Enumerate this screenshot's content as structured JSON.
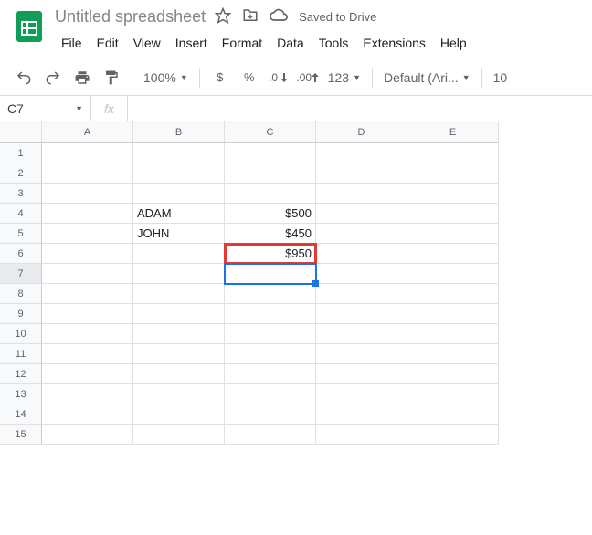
{
  "header": {
    "title": "Untitled spreadsheet",
    "saved_label": "Saved to Drive"
  },
  "menubar": [
    "File",
    "Edit",
    "View",
    "Insert",
    "Format",
    "Data",
    "Tools",
    "Extensions",
    "Help"
  ],
  "toolbar": {
    "zoom": "100%",
    "currency": "$",
    "percent": "%",
    "dec_dec": ".0",
    "inc_dec": ".00",
    "numfmt": "123",
    "font": "Default (Ari...",
    "fontsize": "10"
  },
  "formula_bar": {
    "name_box": "C7",
    "fx": "fx",
    "value": ""
  },
  "columns": [
    "A",
    "B",
    "C",
    "D",
    "E"
  ],
  "rows": [
    {
      "n": "1",
      "cells": [
        "",
        "",
        "",
        "",
        ""
      ]
    },
    {
      "n": "2",
      "cells": [
        "",
        "",
        "",
        "",
        ""
      ]
    },
    {
      "n": "3",
      "cells": [
        "",
        "",
        "",
        "",
        ""
      ]
    },
    {
      "n": "4",
      "cells": [
        "",
        "ADAM",
        "$500",
        "",
        ""
      ]
    },
    {
      "n": "5",
      "cells": [
        "",
        "JOHN",
        "$450",
        "",
        ""
      ]
    },
    {
      "n": "6",
      "cells": [
        "",
        "",
        "$950",
        "",
        ""
      ]
    },
    {
      "n": "7",
      "cells": [
        "",
        "",
        "",
        "",
        ""
      ]
    },
    {
      "n": "8",
      "cells": [
        "",
        "",
        "",
        "",
        ""
      ]
    },
    {
      "n": "9",
      "cells": [
        "",
        "",
        "",
        "",
        ""
      ]
    },
    {
      "n": "10",
      "cells": [
        "",
        "",
        "",
        "",
        ""
      ]
    },
    {
      "n": "11",
      "cells": [
        "",
        "",
        "",
        "",
        ""
      ]
    },
    {
      "n": "12",
      "cells": [
        "",
        "",
        "",
        "",
        ""
      ]
    },
    {
      "n": "13",
      "cells": [
        "",
        "",
        "",
        "",
        ""
      ]
    },
    {
      "n": "14",
      "cells": [
        "",
        "",
        "",
        "",
        ""
      ]
    },
    {
      "n": "15",
      "cells": [
        "",
        "",
        "",
        "",
        ""
      ]
    }
  ],
  "selected_cell": "C7",
  "highlighted_cell": "C6"
}
